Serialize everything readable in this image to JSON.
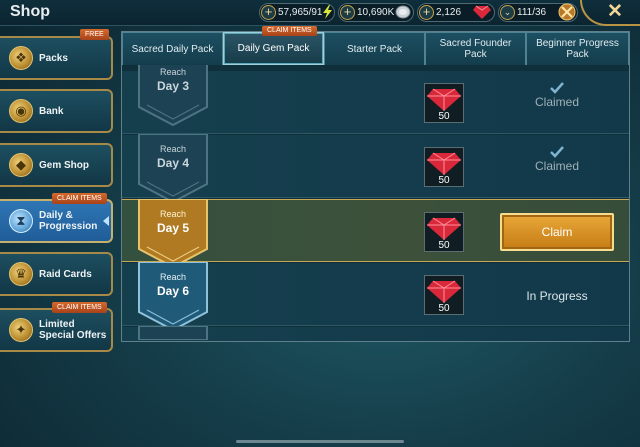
{
  "header": {
    "title": "Shop",
    "resources": [
      {
        "value": "57,965/91",
        "icon": "energy-bolt-icon"
      },
      {
        "value": "10,690K",
        "icon": "silver-coin-icon"
      },
      {
        "value": "2,126",
        "icon": "ruby-gem-icon"
      },
      {
        "value": "111/36",
        "icon": "arena-token-icon"
      }
    ]
  },
  "sidebar": {
    "items": [
      {
        "label": "Packs",
        "tag": "FREE",
        "icon": "pack-icon",
        "active": false
      },
      {
        "label": "Bank",
        "tag": "",
        "icon": "bank-icon",
        "active": false
      },
      {
        "label": "Gem Shop",
        "tag": "",
        "icon": "gem-shop-icon",
        "active": false
      },
      {
        "label": "Daily & Progression",
        "tag": "CLAIM ITEMS",
        "icon": "hourglass-icon",
        "active": true
      },
      {
        "label": "Raid Cards",
        "tag": "",
        "icon": "crown-icon",
        "active": false
      },
      {
        "label": "Limited Special Offers",
        "tag": "CLAIM ITEMS",
        "icon": "special-offer-icon",
        "active": false
      }
    ]
  },
  "tabs": [
    {
      "label": "Sacred Daily Pack",
      "active": false
    },
    {
      "label": "Daily Gem Pack",
      "active": true,
      "tag": "CLAIM ITEMS"
    },
    {
      "label": "Starter Pack",
      "active": false
    },
    {
      "label": "Sacred Founder Pack",
      "active": false
    },
    {
      "label": "Beginner Progress Pack",
      "active": false
    }
  ],
  "rows": [
    {
      "reach": "Reach",
      "day": "Day 3",
      "reward_qty": "50",
      "status": "Claimed",
      "state": "claimed"
    },
    {
      "reach": "Reach",
      "day": "Day 4",
      "reward_qty": "50",
      "status": "Claimed",
      "state": "claimed"
    },
    {
      "reach": "Reach",
      "day": "Day 5",
      "reward_qty": "50",
      "status": "Claim",
      "state": "claimable"
    },
    {
      "reach": "Reach",
      "day": "Day 6",
      "reward_qty": "50",
      "status": "In Progress",
      "state": "in-progress"
    }
  ],
  "colors": {
    "accent_gold": "#caa956",
    "claim_button": "#e0a030",
    "active_tab": "#2f76b5",
    "tag_orange": "#c45a24",
    "ruby": "#d8283a"
  }
}
